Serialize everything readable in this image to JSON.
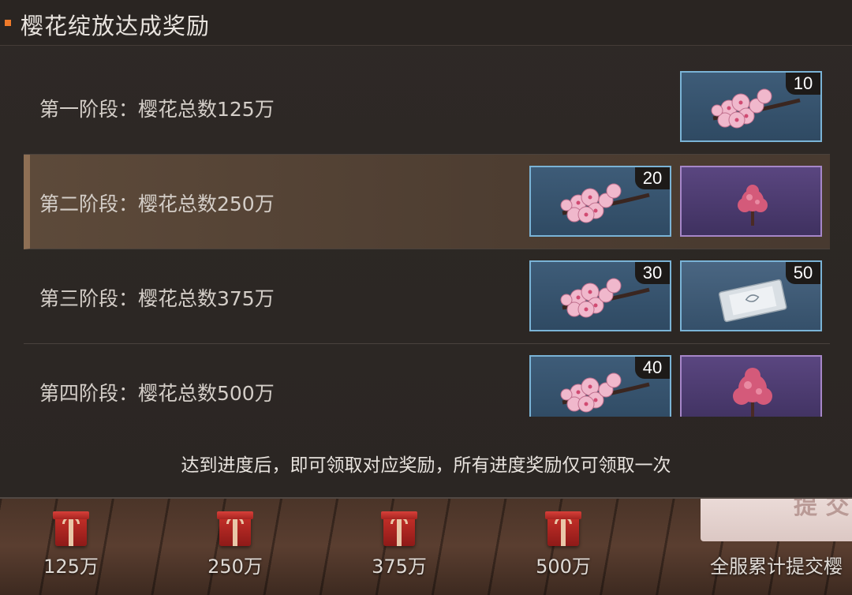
{
  "panel": {
    "title": "樱花绽放达成奖励",
    "rows": [
      {
        "label": "第一阶段：樱花总数125万",
        "rewards": [
          {
            "icon": "sakura-branch-icon",
            "qty": "10",
            "rarity": "blue"
          }
        ]
      },
      {
        "label": "第二阶段：樱花总数250万",
        "rewards": [
          {
            "icon": "sakura-branch-icon",
            "qty": "20",
            "rarity": "blue"
          },
          {
            "icon": "sakura-tree-icon",
            "qty": "",
            "rarity": "purple"
          }
        ]
      },
      {
        "label": "第三阶段：樱花总数375万",
        "rewards": [
          {
            "icon": "sakura-branch-icon",
            "qty": "30",
            "rarity": "blue"
          },
          {
            "icon": "packet-icon",
            "qty": "50",
            "rarity": "blue"
          }
        ]
      },
      {
        "label": "第四阶段：樱花总数500万",
        "rewards": [
          {
            "icon": "sakura-branch-icon",
            "qty": "40",
            "rarity": "blue"
          },
          {
            "icon": "sakura-tree-icon",
            "qty": "",
            "rarity": "purple"
          }
        ]
      }
    ],
    "footer_note": "达到进度后，即可领取对应奖励，所有进度奖励仅可领取一次"
  },
  "background": {
    "gifts": [
      {
        "label": "125万",
        "icon": "gift-box-icon"
      },
      {
        "label": "250万",
        "icon": "gift-box-icon"
      },
      {
        "label": "375万",
        "icon": "gift-box-icon"
      },
      {
        "label": "500万",
        "icon": "gift-box-icon"
      }
    ],
    "submit_button_text": "提 交",
    "server_total_text": "全服累计提交樱"
  },
  "colors": {
    "accent": "#ef7a2a",
    "rarity_blue_border": "#7ab3d6",
    "rarity_purple_border": "#a686c8",
    "highlight_row": "#5d4a3a"
  }
}
